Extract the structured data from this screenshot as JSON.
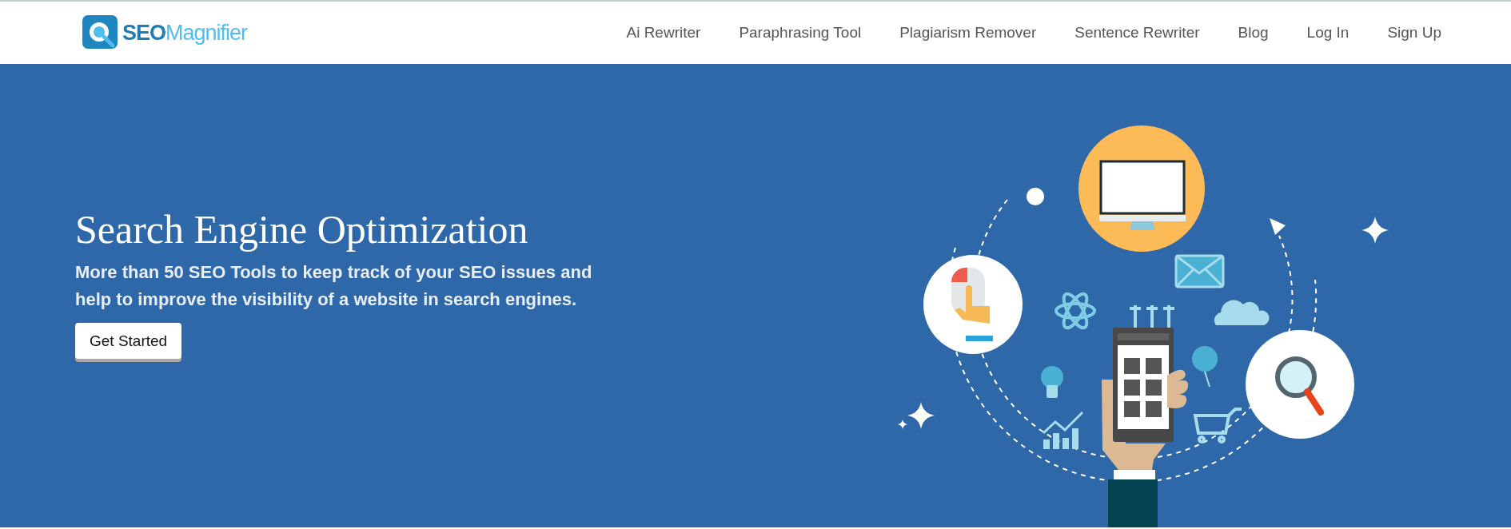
{
  "header": {
    "logo": {
      "strong": "SEO",
      "light": "Magnifier"
    },
    "nav": [
      {
        "label": "Ai Rewriter"
      },
      {
        "label": "Paraphrasing Tool"
      },
      {
        "label": "Plagiarism Remover"
      },
      {
        "label": "Sentence Rewriter"
      },
      {
        "label": "Blog"
      },
      {
        "label": "Log In"
      },
      {
        "label": "Sign Up"
      }
    ]
  },
  "hero": {
    "title": "Search Engine Optimization",
    "description": "More than 50 SEO Tools to keep track of your SEO issues and help to improve the visibility of a website in search engines.",
    "button": "Get Started"
  }
}
